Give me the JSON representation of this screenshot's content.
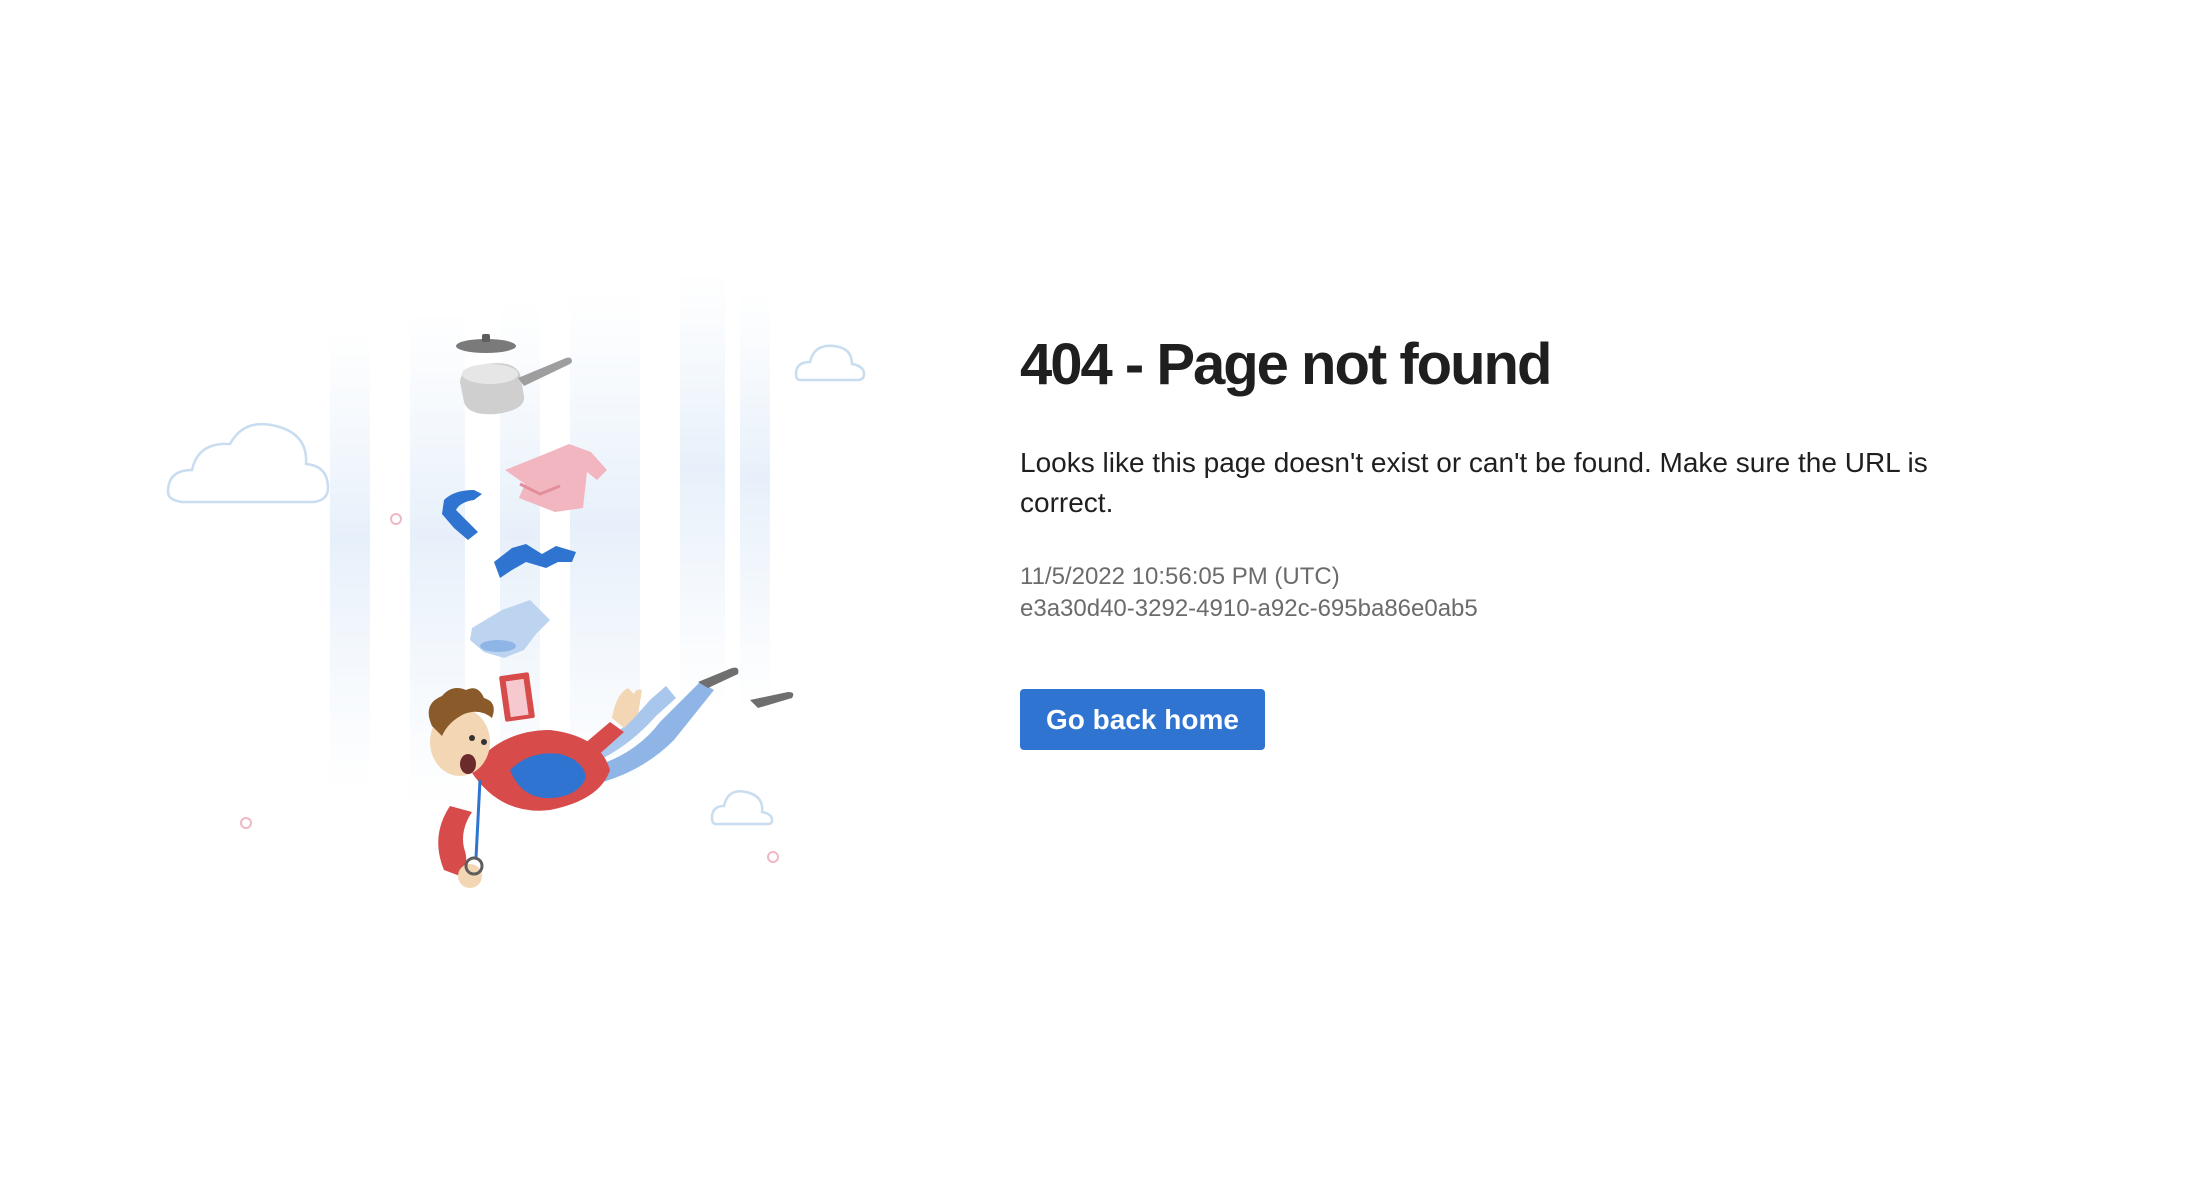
{
  "error": {
    "title": "404 - Page not found",
    "message": "Looks like this page doesn't exist or can't be found. Make sure the URL is correct.",
    "timestamp": "11/5/2022 10:56:05 PM (UTC)",
    "request_id": "e3a30d40-3292-4910-a92c-695ba86e0ab5"
  },
  "actions": {
    "home_label": "Go back home"
  },
  "colors": {
    "button": "#2f74d0",
    "title": "#1f1f1f",
    "meta": "#6b6b6b"
  }
}
